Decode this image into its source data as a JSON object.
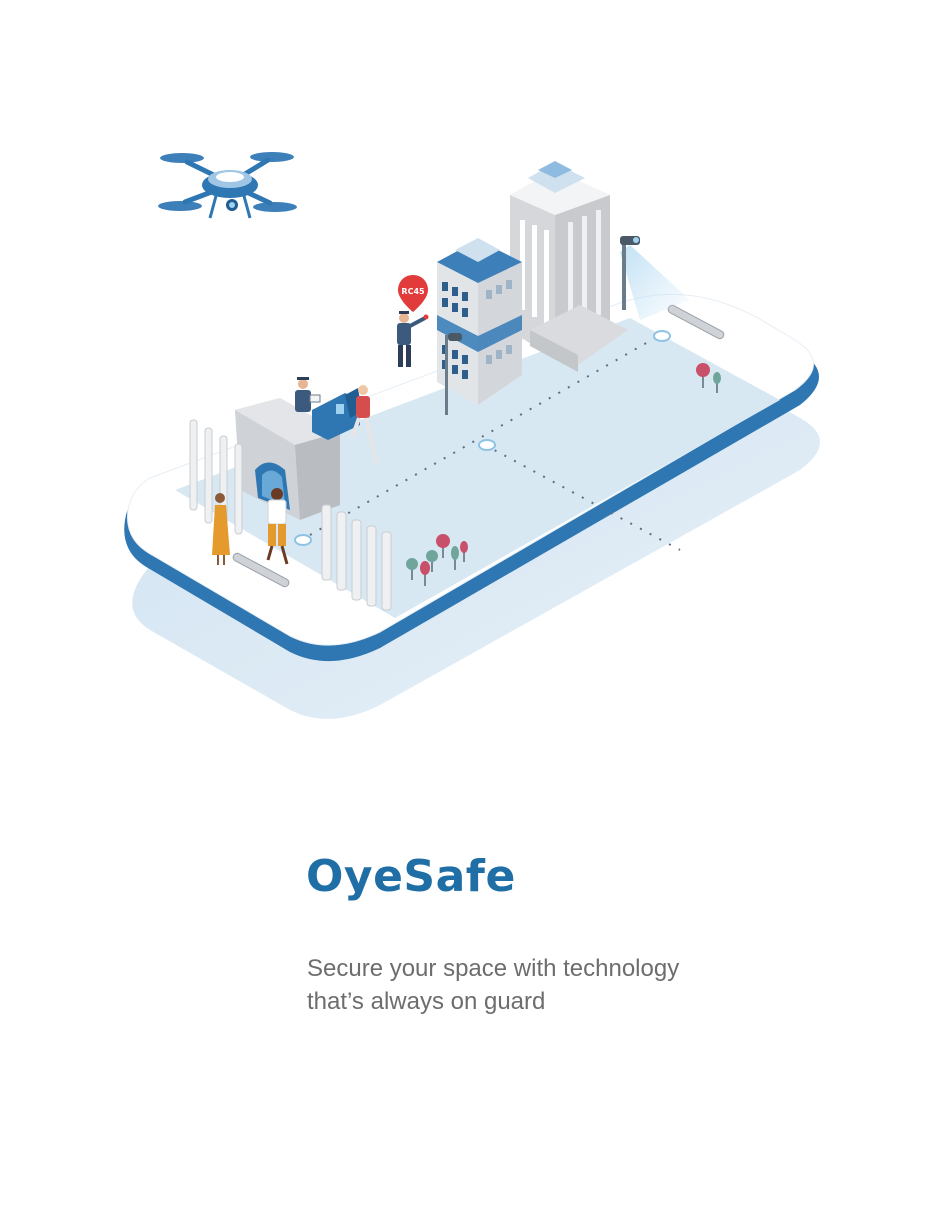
{
  "brand": {
    "title": "OyeSafe",
    "tagline_line1": "Secure your space with technology",
    "tagline_line2": "that’s always on guard",
    "color": "#1f6ea5"
  },
  "illustration": {
    "pin_label": "RC45",
    "colors": {
      "phone_body": "#ffffff",
      "phone_edge": "#2f77b2",
      "phone_shadow": "#dbe9f4",
      "ground": "#d7e8f3",
      "building_blue": "#3d7fb8",
      "building_grey": "#dcdde0",
      "pin_red": "#e23b3b",
      "tree_red": "#c9506a",
      "tree_green": "#6fa59a"
    },
    "elements": [
      "drone-icon",
      "tall-grey-building",
      "blue-office-building",
      "security-camera",
      "location-pin",
      "security-guard",
      "gate-arch",
      "boom-barrier-pillars",
      "trees"
    ]
  }
}
